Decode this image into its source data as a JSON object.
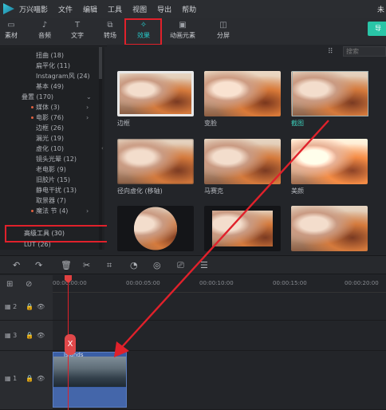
{
  "app": {
    "name": "万兴喵影",
    "menus": [
      "文件",
      "编辑",
      "工具",
      "视图",
      "导出",
      "帮助"
    ],
    "status": "未"
  },
  "toolbar": {
    "tabs": [
      {
        "label": "素材",
        "icon": "folder-icon"
      },
      {
        "label": "音频",
        "icon": "music-note-icon"
      },
      {
        "label": "文字",
        "icon": "text-icon"
      },
      {
        "label": "转场",
        "icon": "transition-icon"
      },
      {
        "label": "效果",
        "icon": "effects-icon",
        "active": true
      },
      {
        "label": "动画元素",
        "icon": "image-icon"
      },
      {
        "label": "分屏",
        "icon": "split-screen-icon"
      }
    ],
    "export_label": "导"
  },
  "sidebar": {
    "items": [
      {
        "label": "扭曲 (18)",
        "indent": 2
      },
      {
        "label": "扁平化 (11)",
        "indent": 2
      },
      {
        "label": "Instagram风 (24)",
        "indent": 2
      },
      {
        "label": "基本 (49)",
        "indent": 2
      },
      {
        "label": "叠置 (170)",
        "indent": 1,
        "chevron": "⌄"
      },
      {
        "label": "媒体 (3)",
        "indent": 2,
        "dot": true,
        "chevron": "›"
      },
      {
        "label": "电影 (76)",
        "indent": 2,
        "dot": true,
        "chevron": "›"
      },
      {
        "label": "边框 (26)",
        "indent": 2
      },
      {
        "label": "漏光 (19)",
        "indent": 2
      },
      {
        "label": "虚化 (10)",
        "indent": 2
      },
      {
        "label": "镜头光晕 (12)",
        "indent": 2
      },
      {
        "label": "老电影 (9)",
        "indent": 2
      },
      {
        "label": "旧胶片 (15)",
        "indent": 2
      },
      {
        "label": "静电干扰 (13)",
        "indent": 2
      },
      {
        "label": "取景器 (7)",
        "indent": 2
      },
      {
        "label": "魔法 节 (4)",
        "indent": 2,
        "dot": true,
        "chevron": "›"
      }
    ],
    "advanced": "高级工具 (30)",
    "lut": "LUT (26)"
  },
  "effects": {
    "search_placeholder": "搜索",
    "grid_icon": "grid-view-icon",
    "items": [
      {
        "label": "边框"
      },
      {
        "label": "变脸"
      },
      {
        "label": "截图",
        "selected": true
      },
      {
        "label": "径向虚化 (移轴)"
      },
      {
        "label": "马赛克"
      },
      {
        "label": "美颜"
      },
      {
        "label": ""
      },
      {
        "label": ""
      },
      {
        "label": ""
      }
    ]
  },
  "timeline": {
    "tools": [
      "undo-icon",
      "redo-icon",
      "delete-icon",
      "cut-icon",
      "crop-icon",
      "speed-icon",
      "color-icon",
      "snapshot-icon",
      "settings-icon"
    ],
    "ruler": [
      "00:00:00:00",
      "00:00:05:00",
      "00:00:10:00",
      "00:00:15:00",
      "00:00:20:00"
    ],
    "tracks": [
      {
        "no": "2"
      },
      {
        "no": "3"
      },
      {
        "no": "1"
      }
    ],
    "clip": {
      "name": "Islands"
    },
    "playhead_icon": "X"
  }
}
